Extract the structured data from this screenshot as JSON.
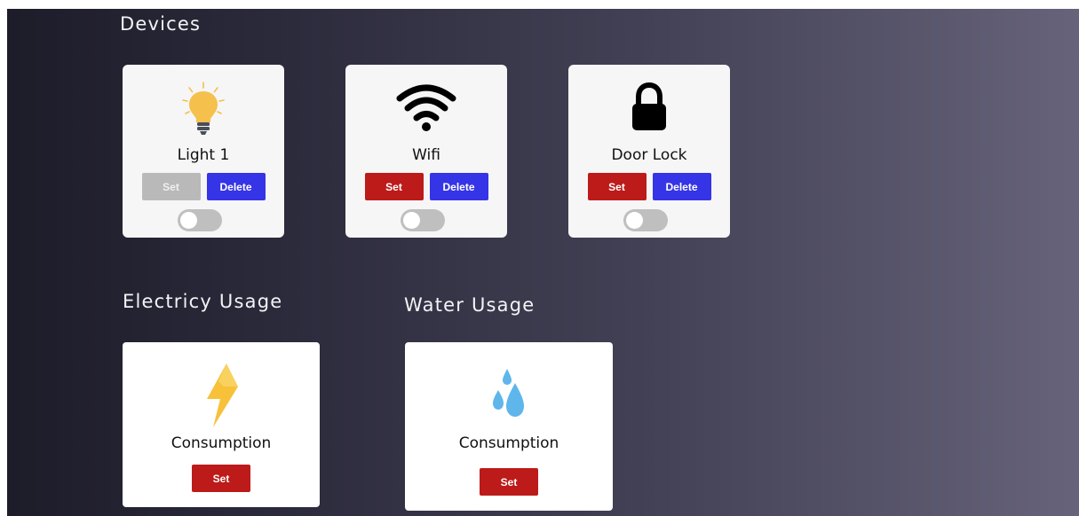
{
  "devices": {
    "title": "Devices",
    "items": [
      {
        "name": "Light 1",
        "icon": "lightbulb-icon",
        "set_label": "Set",
        "delete_label": "Delete",
        "set_enabled": false,
        "toggle_on": false
      },
      {
        "name": "Wifi",
        "icon": "wifi-icon",
        "set_label": "Set",
        "delete_label": "Delete",
        "set_enabled": true,
        "toggle_on": false
      },
      {
        "name": "Door Lock",
        "icon": "lock-icon",
        "set_label": "Set",
        "delete_label": "Delete",
        "set_enabled": true,
        "toggle_on": false
      }
    ]
  },
  "electricity": {
    "title": "Electricy Usage",
    "icon": "lightning-icon",
    "label": "Consumption",
    "set_label": "Set"
  },
  "water": {
    "title": "Water Usage",
    "icon": "water-drops-icon",
    "label": "Consumption",
    "set_label": "Set"
  },
  "colors": {
    "set_button": "#bd1a1a",
    "set_button_disabled": "#b9b9b9",
    "delete_button": "#3534e6",
    "card_background": "#f6f6f6"
  }
}
